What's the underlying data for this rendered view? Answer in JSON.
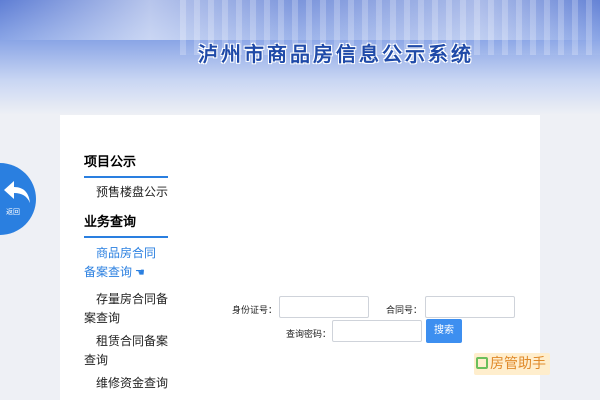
{
  "header": {
    "title": "泸州市商品房信息公示系统"
  },
  "back_button": {
    "label": "返回"
  },
  "sidebar": {
    "section1_title": "项目公示",
    "section1_items": [
      "预售楼盘公示"
    ],
    "section2_title": "业务查询",
    "section2_items": [
      {
        "line1": "商品房合同",
        "line2": "备案查询",
        "active": true
      },
      {
        "line1": "存量房合同备",
        "line2": "案查询",
        "active": false
      },
      {
        "line1": "租赁合同备案",
        "line2": "查询",
        "active": false
      },
      {
        "line1": "维修资金查询",
        "line2": "",
        "active": false
      }
    ]
  },
  "form": {
    "id_label": "身份证号：",
    "contract_label": "合同号：",
    "password_label": "查询密码：",
    "id_value": "",
    "contract_value": "",
    "password_value": "",
    "search_label": "搜索"
  },
  "watermark": {
    "text": "房管助手"
  },
  "colors": {
    "accent": "#2a7fe0",
    "title": "#1f4aa8",
    "button": "#3d8ff0"
  }
}
